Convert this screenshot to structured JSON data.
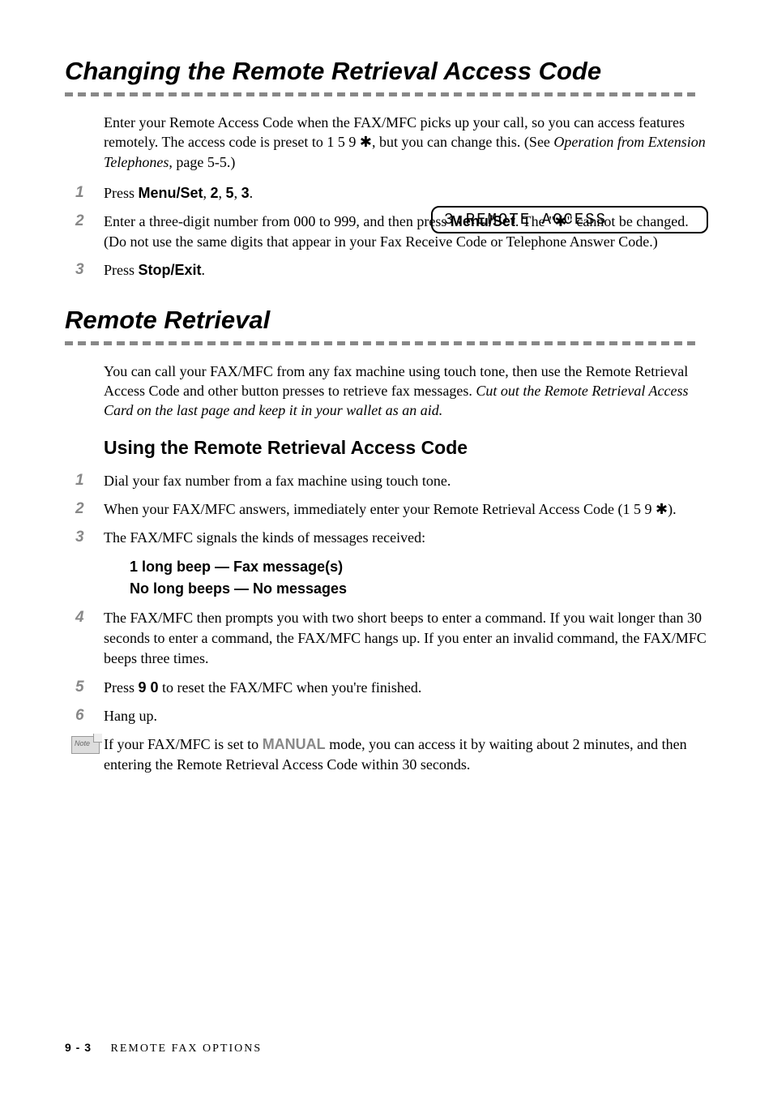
{
  "section1": {
    "title": "Changing the Remote Retrieval Access Code",
    "intro_p1": "Enter your Remote Access Code when the FAX/MFC picks up your call, so you can access features remotely.  The access code is preset to 1 5 9 ✱, but you can change this. (See ",
    "intro_italic": "Operation from Extension Telephones",
    "intro_p2": ", page 5-5.)",
    "display_text": "3.REMOTE ACCESS",
    "step1_a": "Press ",
    "step1_b": "Menu/Set",
    "step1_c": ", ",
    "step1_d": "2",
    "step1_e": ", ",
    "step1_f": "5",
    "step1_g": ", ",
    "step1_h": "3",
    "step1_i": ".",
    "step2_a": "Enter a three-digit number from 000 to 999, and then press ",
    "step2_b": "Menu/Set",
    "step2_c": ". The \"✱\" cannot be changed. (Do not use the same digits that appear in your Fax Receive Code or Telephone Answer Code.)",
    "step3_a": "Press ",
    "step3_b": "Stop/Exit",
    "step3_c": "."
  },
  "section2": {
    "title": "Remote Retrieval",
    "intro_a": "You can call your FAX/MFC from any fax machine using touch tone, then use the Remote Retrieval Access Code and other button presses to retrieve fax messages. ",
    "intro_italic": "Cut out the Remote Retrieval Access Card on the last page and keep it in your wallet as an aid.",
    "subsection_title": "Using the Remote Retrieval Access Code",
    "step1": "Dial your fax number from a fax machine using touch tone.",
    "step2": "When your FAX/MFC answers, immediately enter your Remote Retrieval Access Code (1 5 9 ✱).",
    "step3": "The FAX/MFC signals the kinds of messages received:",
    "beep1": "1 long beep — Fax message(s)",
    "beep2": "No long beeps — No messages",
    "step4": "The FAX/MFC then prompts you with two short beeps to enter a command.  If you wait longer than 30 seconds to enter a command, the FAX/MFC hangs up.  If you enter an invalid command, the FAX/MFC beeps three times.",
    "step5_a": "Press ",
    "step5_b": "9 0",
    "step5_c": " to reset the FAX/MFC when you're finished.",
    "step6": "Hang up.",
    "note_a": "If your FAX/MFC is set to ",
    "note_manual": "MANUAL",
    "note_b": " mode, you can access it by waiting about 2 minutes, and then entering the Remote Retrieval Access Code within 30 seconds."
  },
  "footer": {
    "page": "9 - 3",
    "chapter": "REMOTE FAX OPTIONS"
  }
}
